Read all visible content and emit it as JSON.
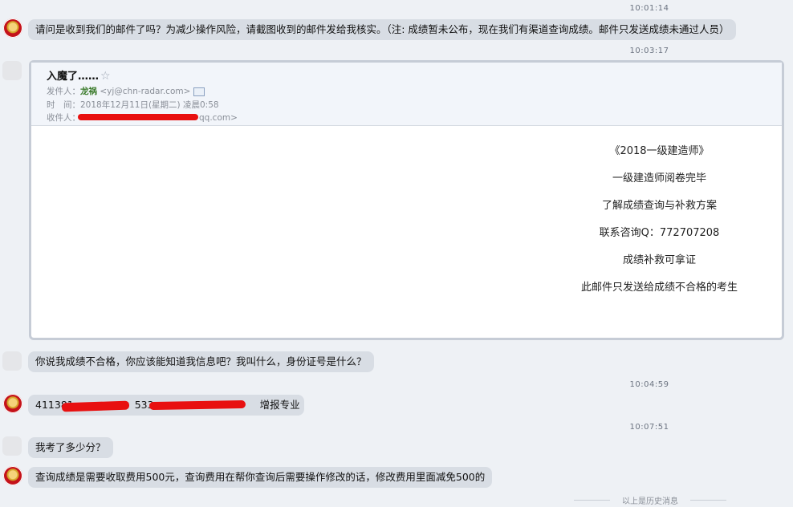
{
  "messages": [
    {
      "time": "10:01:14",
      "text": "请问是收到我们的邮件了吗？为减少操作风险，请截图收到的邮件发给我核实。（注: 成绩暂未公布，现在我们有渠道查询成绩。邮件只发送成绩未通过人员）"
    },
    {
      "time": "10:03:17"
    },
    {
      "text": "你说我成绩不合格，你应该能知道我信息吧？我叫什么，身份证号是什么？"
    },
    {
      "time": "10:04:59",
      "text_a": "411381",
      "text_b": "533",
      "text_c": "增报专业"
    },
    {
      "time": "10:07:51",
      "text": "我考了多少分？"
    },
    {
      "text": "查询成绩是需要收取费用500元，查询费用在帮你查询后需要操作修改的话，修改费用里面减免500的"
    }
  ],
  "email": {
    "subject": "入魔了……",
    "star": "☆",
    "from_label": "发件人：",
    "from_name": "龙祸",
    "from_addr": "<yj@chn-radar.com>",
    "time_label": "时　间：",
    "time_value": "2018年12月11日(星期二) 凌晨0:58",
    "to_label": "收件人：",
    "to_addr": "qq.com>",
    "body": [
      "《2018一级建造师》",
      "一级建造师阅卷完毕",
      "了解成绩查询与补救方案",
      "联系咨询Q：772707208",
      "成绩补救可拿证",
      "此邮件只发送给成绩不合格的考生"
    ]
  },
  "history_label": "以上是历史消息"
}
